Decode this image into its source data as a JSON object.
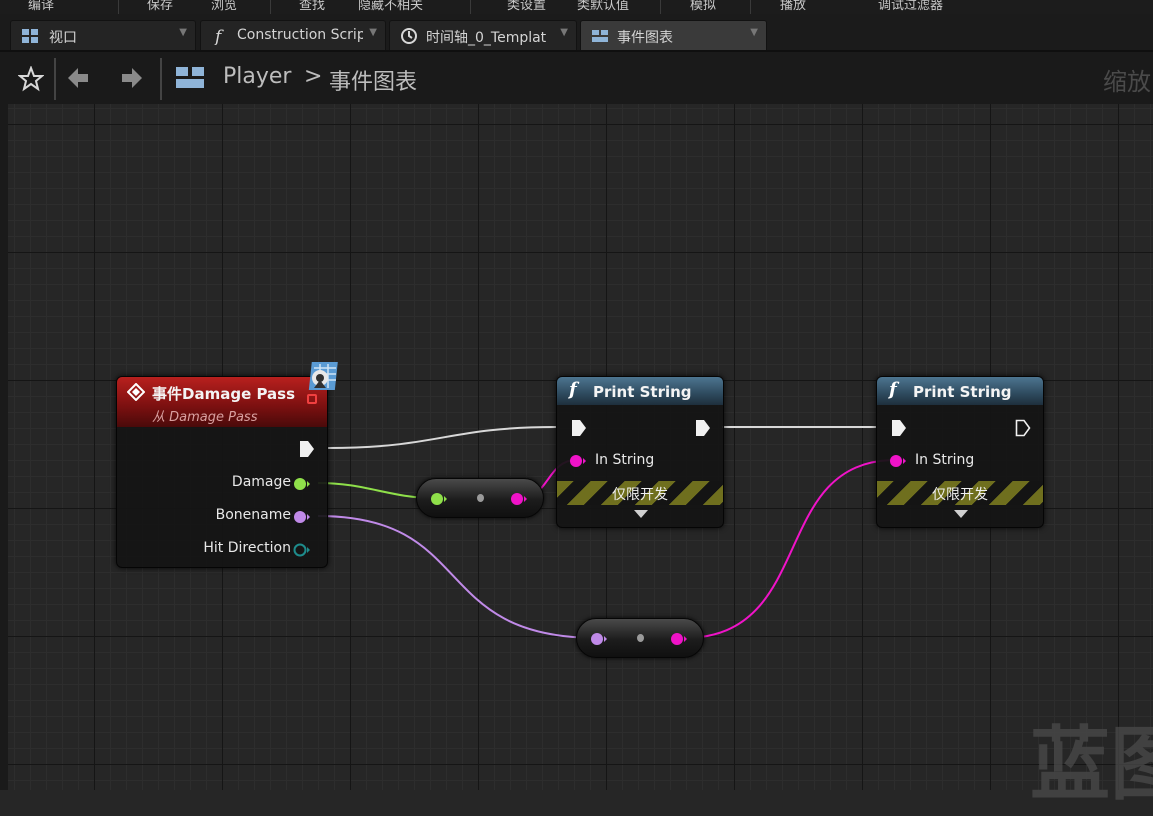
{
  "menubar": {
    "items": [
      "编译",
      "保存",
      "浏览",
      "查找",
      "隐藏不相关",
      "类设置",
      "类默认值",
      "模拟",
      "播放",
      "调试过滤器"
    ]
  },
  "tabs": [
    {
      "label": "视口",
      "icon": "viewport-icon",
      "active": false
    },
    {
      "label": "Construction Scrip",
      "icon": "function-icon",
      "active": false
    },
    {
      "label": "时间轴_0_Templat",
      "icon": "clock-icon",
      "active": false
    },
    {
      "label": "事件图表",
      "icon": "event-graph-icon",
      "active": true
    }
  ],
  "breadcrumb": {
    "root": "Player",
    "separator": ">",
    "current": "事件图表"
  },
  "zoom_label": "缩放",
  "watermark": "蓝图",
  "nodes": {
    "event": {
      "title": "事件Damage Pass",
      "subtitle": "从 Damage Pass",
      "pins": [
        "Damage",
        "Bonename",
        "Hit Direction"
      ]
    },
    "print1": {
      "title": "Print String",
      "in_string": "In String",
      "dev_only": "仅限开发"
    },
    "print2": {
      "title": "Print String",
      "in_string": "In String",
      "dev_only": "仅限开发"
    }
  },
  "colors": {
    "exec": "#f0f0f0",
    "float_pin": "#8fe04a",
    "name_pin": "#c08ae8",
    "string_pin": "#f013c8",
    "vector_pin": "#1e8c8c",
    "event_header": "#a81c1a",
    "function_header": "#3d6580"
  }
}
